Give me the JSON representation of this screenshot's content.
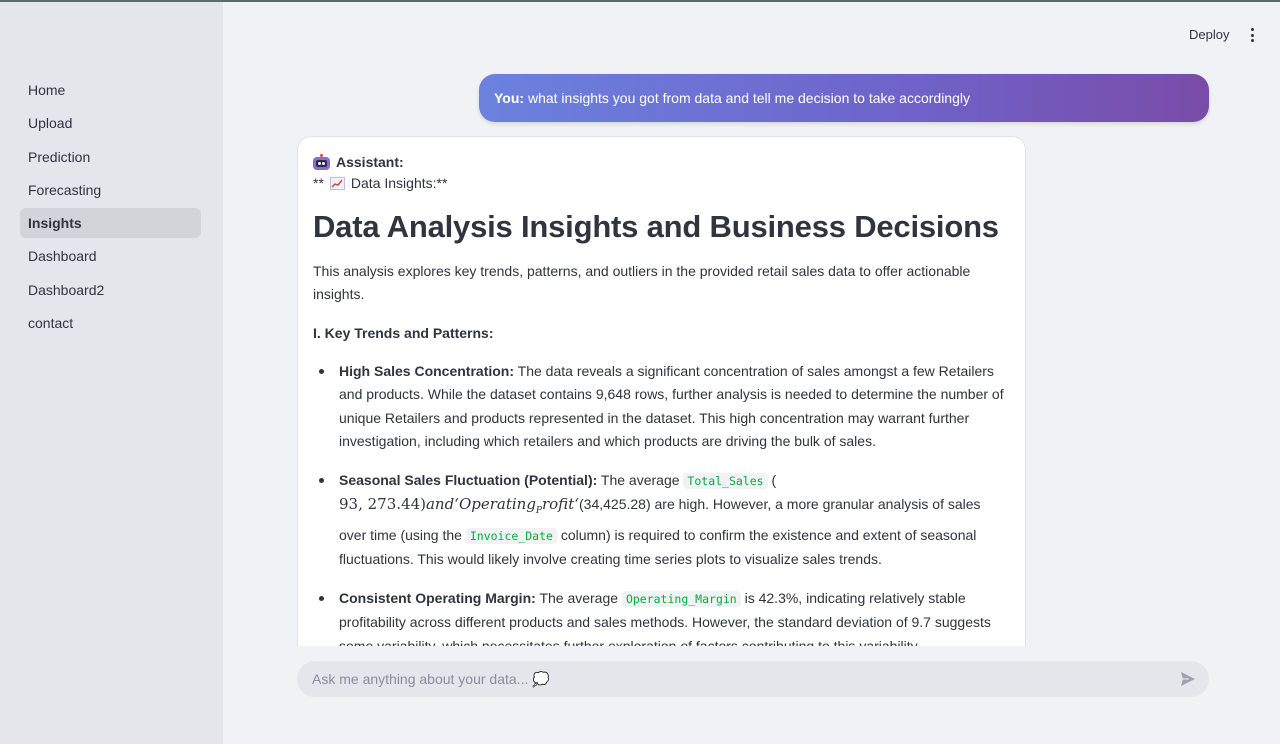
{
  "sidebar": {
    "items": [
      {
        "label": "Home",
        "active": false
      },
      {
        "label": "Upload",
        "active": false
      },
      {
        "label": "Prediction",
        "active": false
      },
      {
        "label": "Forecasting",
        "active": false
      },
      {
        "label": "Insights",
        "active": true
      },
      {
        "label": "Dashboard",
        "active": false
      },
      {
        "label": "Dashboard2",
        "active": false
      },
      {
        "label": "contact",
        "active": false
      }
    ]
  },
  "header": {
    "deploy_label": "Deploy",
    "menu_icon": "kebab-menu-icon"
  },
  "user_message": {
    "prefix": "You:",
    "text": "what insights you got from data and tell me decision to take accordingly"
  },
  "assistant": {
    "label": "Assistant:",
    "avatar_icon": "robot-icon",
    "insights_prefix": "**",
    "insights_icon": "chart-increasing-icon",
    "insights_label": "Data Insights:**",
    "heading": "Data Analysis Insights and Business Decisions",
    "intro": "This analysis explores key trends, patterns, and outliers in the provided retail sales data to offer actionable insights.",
    "section_1": "I. Key Trends and Patterns:",
    "bullets": [
      {
        "title": "High Sales Concentration:",
        "text": "The data reveals a significant concentration of sales amongst a few Retailers and products. While the dataset contains 9,648 rows, further analysis is needed to determine the number of unique Retailers and products represented in the dataset. This high concentration may warrant further investigation, including which retailers and which products are driving the bulk of sales."
      },
      {
        "title": "Seasonal Sales Fluctuation (Potential):",
        "pre": "The average",
        "code1": "Total_Sales",
        "paren": "(",
        "math_num": "93, 273.44)",
        "math_and": "and‘Operating",
        "math_sub": "P",
        "math_rofit": "rofit‘",
        "paren2": "(",
        "value2": "34,425.28) are high. However, a more granular analysis of sales over time (using the",
        "code2": "Invoice_Date",
        "post": "column) is required to confirm the existence and extent of seasonal fluctuations. This would likely involve creating time series plots to visualize sales trends."
      },
      {
        "title": "Consistent Operating Margin:",
        "pre": "The average",
        "code1": "Operating_Margin",
        "post": "is 42.3%, indicating relatively stable profitability across different products and sales methods. However, the standard deviation of 9.7 suggests some variability, which necessitates further exploration of factors contributing to this variability."
      }
    ]
  },
  "chat_input": {
    "placeholder": "Ask me anything about your data... 💭",
    "send_icon": "send-icon"
  }
}
